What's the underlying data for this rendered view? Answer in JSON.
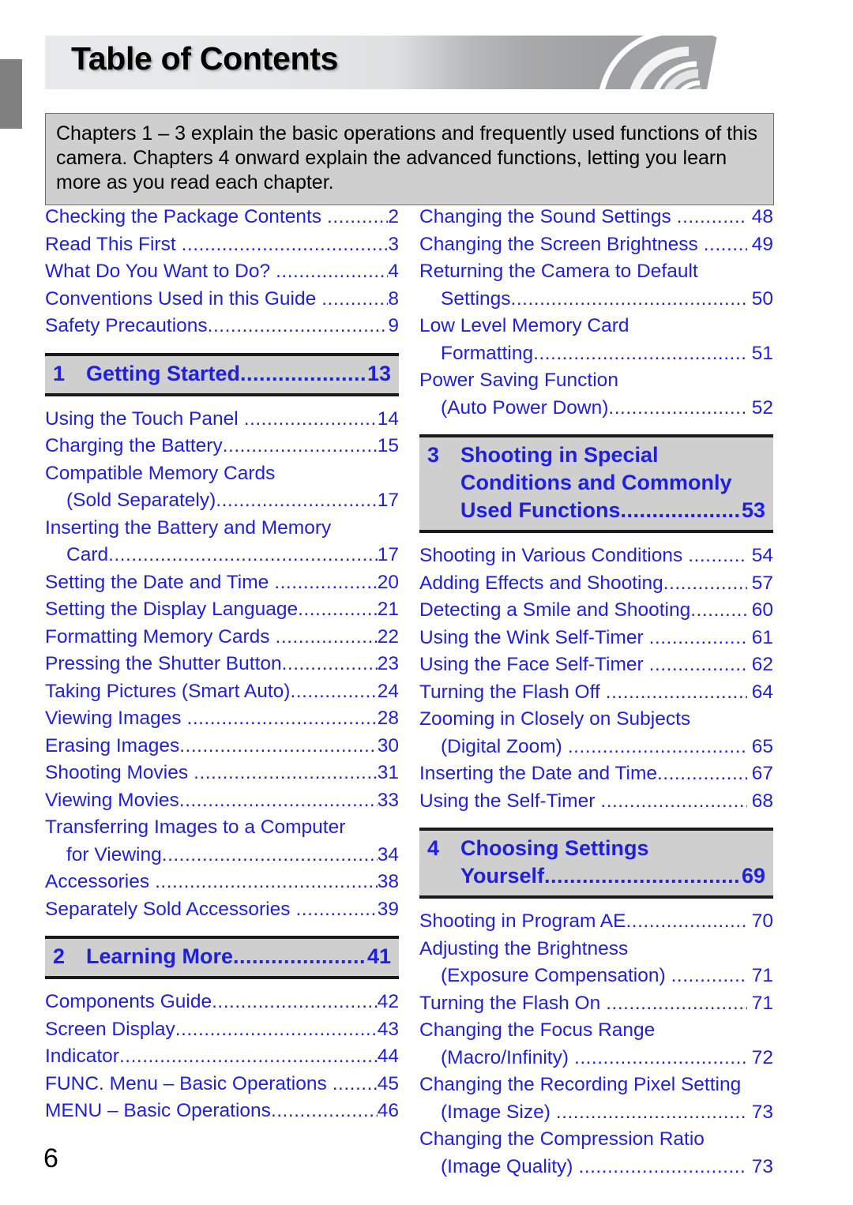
{
  "page": {
    "title": "Table of Contents",
    "page_number": "6",
    "accent_color": "#1f1fe0",
    "bar_color": "#cfcfcf"
  },
  "intro": {
    "text": "Chapters 1 – 3 explain the basic operations and frequently used functions of this camera. Chapters 4 onward explain the advanced functions, letting you learn more as you read each chapter."
  },
  "left_column": {
    "front_matter": [
      {
        "title": "Checking the Package Contents",
        "page": "2"
      },
      {
        "title": "Read This First",
        "page": "3"
      },
      {
        "title": "What Do You Want to Do?",
        "page": "4"
      },
      {
        "title": "Conventions Used in this Guide",
        "page": "8"
      },
      {
        "title": "Safety Precautions",
        "page": "9"
      }
    ],
    "chapter1": {
      "number": "1",
      "title": "Getting Started",
      "page": "13",
      "entries": [
        {
          "line1": "Using the Touch Panel",
          "page": "14"
        },
        {
          "line1": "Charging the Battery",
          "page": "15"
        },
        {
          "line1": "Compatible Memory Cards",
          "line2": "(Sold Separately)",
          "page": "17"
        },
        {
          "line1": "Inserting the Battery and Memory",
          "line2": "Card",
          "page": "17"
        },
        {
          "line1": "Setting the Date and Time",
          "page": "20"
        },
        {
          "line1": "Setting the Display Language",
          "page": "21"
        },
        {
          "line1": "Formatting Memory Cards",
          "page": "22"
        },
        {
          "line1": "Pressing the Shutter Button",
          "page": "23"
        },
        {
          "line1": "Taking Pictures (Smart Auto)",
          "page": "24"
        },
        {
          "line1": "Viewing Images",
          "page": "28"
        },
        {
          "line1": "Erasing Images",
          "page": "30"
        },
        {
          "line1": "Shooting Movies",
          "page": "31"
        },
        {
          "line1": "Viewing Movies",
          "page": "33"
        },
        {
          "line1": "Transferring Images to a Computer",
          "line2": "for Viewing",
          "page": "34"
        },
        {
          "line1": "Accessories",
          "page": "38"
        },
        {
          "line1": "Separately Sold Accessories",
          "page": "39"
        }
      ]
    },
    "chapter2": {
      "number": "2",
      "title": "Learning More",
      "page": "41",
      "entries": [
        {
          "line1": "Components Guide",
          "page": "42"
        },
        {
          "line1": "Screen Display",
          "page": "43"
        },
        {
          "line1": "Indicator",
          "page": "44"
        },
        {
          "line1": "FUNC. Menu – Basic Operations",
          "page": "45"
        },
        {
          "line1": "MENU – Basic Operations",
          "page": "46"
        }
      ]
    }
  },
  "right_column": {
    "chapter2_cont_entries": [
      {
        "line1": "Changing the Sound Settings",
        "page": "48"
      },
      {
        "line1": "Changing the Screen Brightness",
        "page": "49"
      },
      {
        "line1": "Returning the Camera to Default",
        "line2": "Settings",
        "page": "50"
      },
      {
        "line1": "Low Level Memory Card",
        "line2": "Formatting",
        "page": "51"
      },
      {
        "line1": "Power Saving Function",
        "line2": "(Auto Power Down)",
        "page": "52"
      }
    ],
    "chapter3": {
      "number": "3",
      "title_line1": "Shooting in Special",
      "title_line2": "Conditions and Commonly",
      "title_line3": "Used Functions",
      "page": "53",
      "entries": [
        {
          "line1": "Shooting in Various Conditions",
          "page": "54"
        },
        {
          "line1": "Adding Effects and Shooting",
          "page": "57"
        },
        {
          "line1": "Detecting a Smile and Shooting",
          "page": "60"
        },
        {
          "line1": "Using the Wink Self-Timer",
          "page": "61"
        },
        {
          "line1": "Using the Face Self-Timer",
          "page": "62"
        },
        {
          "line1": "Turning the Flash Off",
          "page": "64"
        },
        {
          "line1": "Zooming in Closely on Subjects",
          "line2": "(Digital Zoom)",
          "page": "65"
        },
        {
          "line1": "Inserting the Date and Time",
          "page": "67"
        },
        {
          "line1": "Using the Self-Timer",
          "page": "68"
        }
      ]
    },
    "chapter4": {
      "number": "4",
      "title_line1": "Choosing Settings",
      "title_line2": "Yourself",
      "page": "69",
      "entries": [
        {
          "line1": "Shooting in Program AE",
          "page": "70"
        },
        {
          "line1": "Adjusting the Brightness",
          "line2": "(Exposure Compensation)",
          "page": "71"
        },
        {
          "line1": "Turning the Flash On",
          "page": "71"
        },
        {
          "line1": "Changing the Focus Range",
          "line2": "(Macro/Infinity)",
          "page": "72"
        },
        {
          "line1": "Changing the Recording Pixel Setting",
          "line2": "(Image Size)",
          "page": "73"
        },
        {
          "line1": "Changing the Compression Ratio",
          "line2": "(Image Quality)",
          "page": "73"
        }
      ]
    }
  }
}
